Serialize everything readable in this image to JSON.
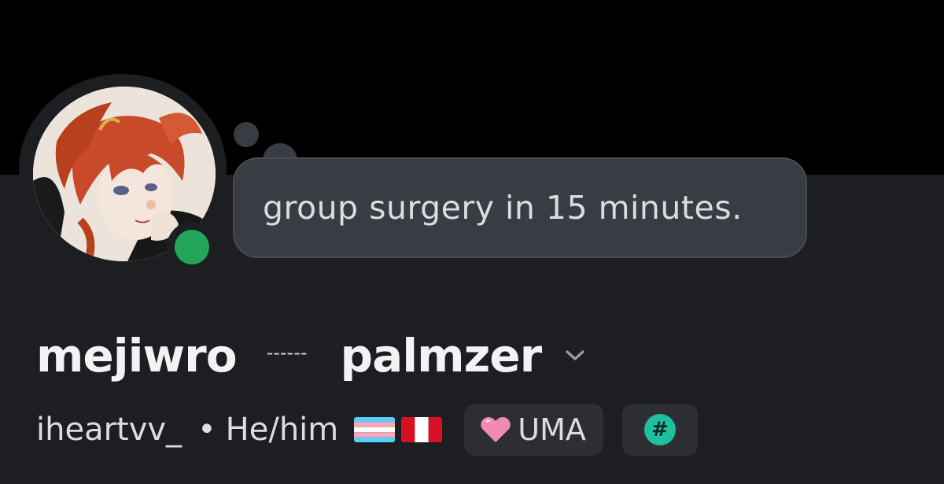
{
  "colors": {
    "banner": "#000000",
    "panel": "#1d1e22",
    "bubble": "#3a3c43",
    "status_online": "#23a55a",
    "badge_teal": "#1fbf9f"
  },
  "profile": {
    "avatar_icon": "avatar-anime-character",
    "status": "online",
    "custom_status": "group surgery in 15 minutes.",
    "display_name_1": "mejiwro",
    "separator": "------",
    "display_name_2": "palmzer",
    "username": "iheartvv_",
    "bullet": "•",
    "pronouns": "He/him",
    "flags": [
      "transgender-flag",
      "peru-flag"
    ],
    "badges": [
      {
        "icon": "pink-heart-icon",
        "label": "UMA"
      },
      {
        "icon": "hashtag-icon",
        "label": "#"
      }
    ]
  }
}
